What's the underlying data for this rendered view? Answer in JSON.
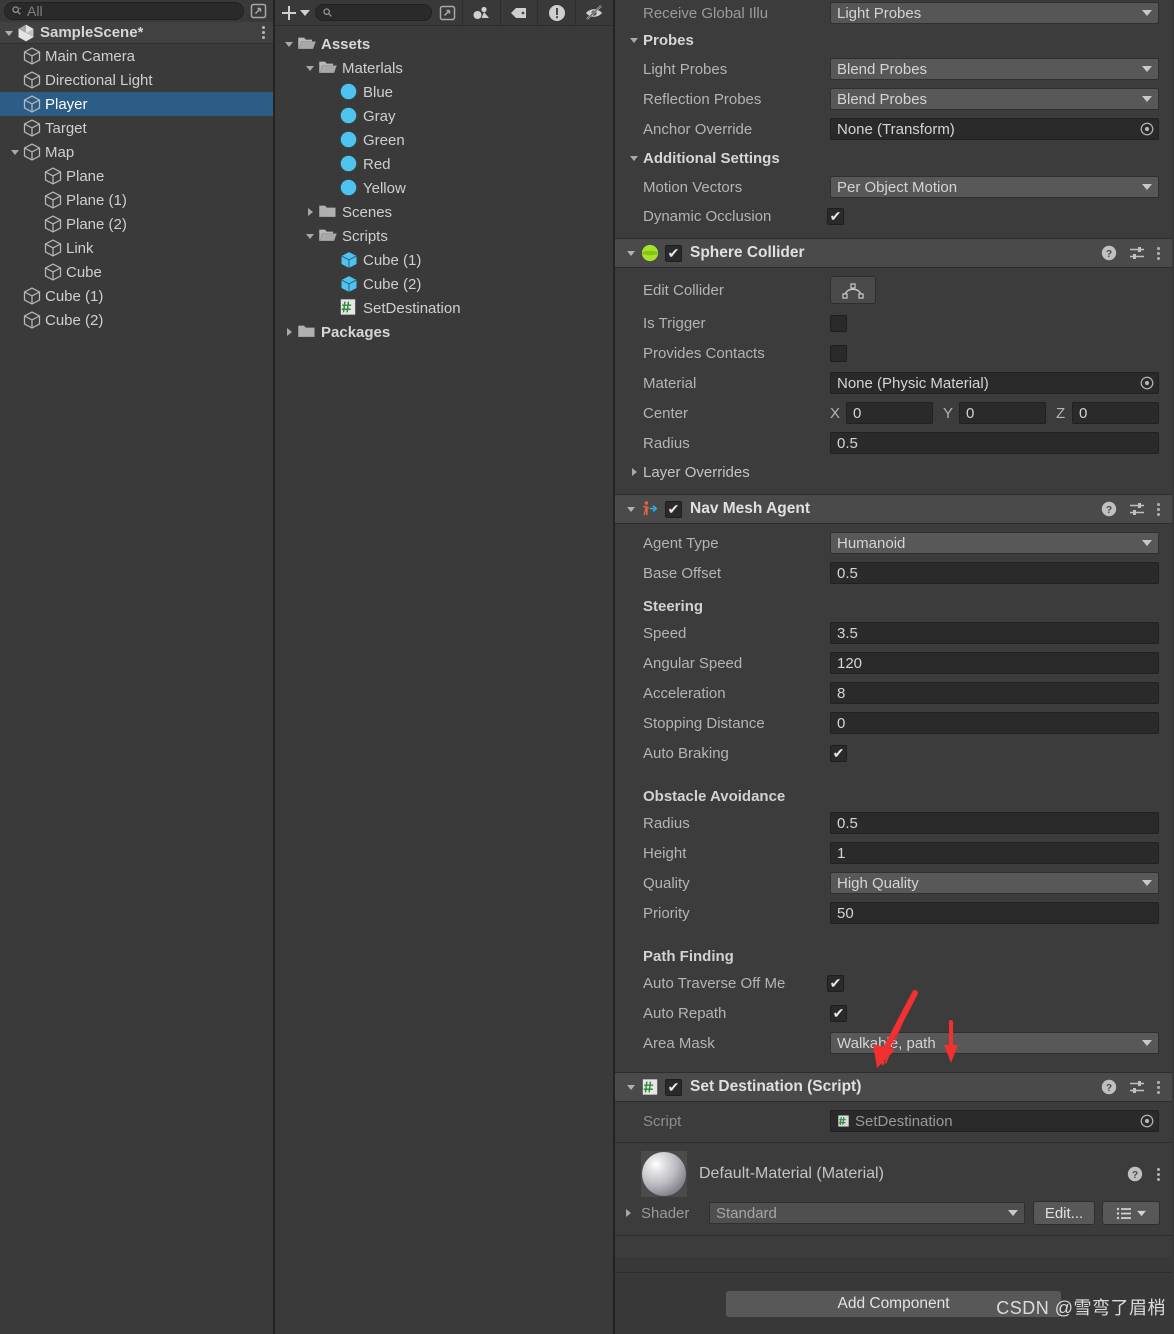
{
  "hierarchy": {
    "search": {
      "placeholder": "All",
      "icon": "search-icon"
    },
    "scene": {
      "name": "SampleScene*",
      "icon": "unity-scene-icon"
    },
    "items": [
      {
        "label": "Main Camera",
        "depth": 1,
        "expandable": false,
        "selected": false
      },
      {
        "label": "Directional Light",
        "depth": 1,
        "expandable": false,
        "selected": false
      },
      {
        "label": "Player",
        "depth": 1,
        "expandable": false,
        "selected": true
      },
      {
        "label": "Target",
        "depth": 1,
        "expandable": false,
        "selected": false
      },
      {
        "label": "Map",
        "depth": 1,
        "expandable": true,
        "expanded": true,
        "selected": false
      },
      {
        "label": "Plane",
        "depth": 2,
        "expandable": false,
        "selected": false
      },
      {
        "label": "Plane (1)",
        "depth": 2,
        "expandable": false,
        "selected": false
      },
      {
        "label": "Plane (2)",
        "depth": 2,
        "expandable": false,
        "selected": false
      },
      {
        "label": "Link",
        "depth": 2,
        "expandable": false,
        "selected": false
      },
      {
        "label": "Cube",
        "depth": 2,
        "expandable": false,
        "selected": false
      },
      {
        "label": "Cube (1)",
        "depth": 1,
        "expandable": false,
        "selected": false
      },
      {
        "label": "Cube (2)",
        "depth": 1,
        "expandable": false,
        "selected": false
      }
    ]
  },
  "project": {
    "toolbar": {
      "create_label": "+",
      "search_placeholder": "",
      "icons": [
        "plus-icon",
        "chevron-down-icon",
        "search-icon",
        "expand-icon",
        "favorite-icon",
        "label-icon",
        "error-icon",
        "hidden-icon"
      ]
    },
    "items": [
      {
        "label": "Assets",
        "depth": 0,
        "kind": "folder-open",
        "expandable": true,
        "expanded": true,
        "bold": true
      },
      {
        "label": "Materlals",
        "depth": 1,
        "kind": "folder-open",
        "expandable": true,
        "expanded": true,
        "bold": false
      },
      {
        "label": "Blue",
        "depth": 2,
        "kind": "material",
        "expandable": false,
        "bold": false
      },
      {
        "label": "Gray",
        "depth": 2,
        "kind": "material",
        "expandable": false,
        "bold": false
      },
      {
        "label": "Green",
        "depth": 2,
        "kind": "material",
        "expandable": false,
        "bold": false
      },
      {
        "label": "Red",
        "depth": 2,
        "kind": "material",
        "expandable": false,
        "bold": false
      },
      {
        "label": "Yellow",
        "depth": 2,
        "kind": "material",
        "expandable": false,
        "bold": false
      },
      {
        "label": "Scenes",
        "depth": 1,
        "kind": "folder",
        "expandable": true,
        "expanded": false,
        "bold": false
      },
      {
        "label": "Scripts",
        "depth": 1,
        "kind": "folder-open",
        "expandable": true,
        "expanded": true,
        "bold": false
      },
      {
        "label": "Cube (1)",
        "depth": 2,
        "kind": "prefab",
        "expandable": false,
        "bold": false
      },
      {
        "label": "Cube (2)",
        "depth": 2,
        "kind": "prefab",
        "expandable": false,
        "bold": false
      },
      {
        "label": "SetDestination",
        "depth": 2,
        "kind": "script",
        "expandable": false,
        "bold": false
      },
      {
        "label": "Packages",
        "depth": 0,
        "kind": "folder",
        "expandable": true,
        "expanded": false,
        "bold": true
      }
    ]
  },
  "inspector": {
    "renderer_tail": {
      "receive_gi_label": "Receive Global Illu",
      "receive_gi_value": "Light Probes",
      "probes_header": "Probes",
      "light_probes_label": "Light Probes",
      "light_probes_value": "Blend Probes",
      "reflection_probes_label": "Reflection Probes",
      "reflection_probes_value": "Blend Probes",
      "anchor_override_label": "Anchor Override",
      "anchor_override_value": "None (Transform)",
      "additional_settings_header": "Additional Settings",
      "motion_vectors_label": "Motion Vectors",
      "motion_vectors_value": "Per Object Motion",
      "dynamic_occlusion_label": "Dynamic Occlusion",
      "dynamic_occlusion_checked": true
    },
    "sphere_collider": {
      "title": "Sphere Collider",
      "enabled": true,
      "icon": "sphere-collider-icon",
      "edit_collider_label": "Edit Collider",
      "is_trigger_label": "Is Trigger",
      "is_trigger_checked": false,
      "provides_contacts_label": "Provides Contacts",
      "provides_contacts_checked": false,
      "material_label": "Material",
      "material_value": "None (Physic Material)",
      "center_label": "Center",
      "center_x_axis": "X",
      "center_x": "0",
      "center_y_axis": "Y",
      "center_y": "0",
      "center_z_axis": "Z",
      "center_z": "0",
      "radius_label": "Radius",
      "radius_value": "0.5",
      "layer_overrides_label": "Layer Overrides"
    },
    "nav_mesh_agent": {
      "title": "Nav Mesh Agent",
      "enabled": true,
      "icon": "nav-mesh-agent-icon",
      "agent_type_label": "Agent Type",
      "agent_type_value": "Humanoid",
      "base_offset_label": "Base Offset",
      "base_offset_value": "0.5",
      "steering_header": "Steering",
      "speed_label": "Speed",
      "speed_value": "3.5",
      "angular_speed_label": "Angular Speed",
      "angular_speed_value": "120",
      "acceleration_label": "Acceleration",
      "acceleration_value": "8",
      "stopping_distance_label": "Stopping Distance",
      "stopping_distance_value": "0",
      "auto_braking_label": "Auto Braking",
      "auto_braking_checked": true,
      "obstacle_avoidance_header": "Obstacle Avoidance",
      "oa_radius_label": "Radius",
      "oa_radius_value": "0.5",
      "oa_height_label": "Height",
      "oa_height_value": "1",
      "oa_quality_label": "Quality",
      "oa_quality_value": "High Quality",
      "oa_priority_label": "Priority",
      "oa_priority_value": "50",
      "path_finding_header": "Path Finding",
      "auto_traverse_label": "Auto Traverse Off Me",
      "auto_traverse_checked": true,
      "auto_repath_label": "Auto Repath",
      "auto_repath_checked": true,
      "area_mask_label": "Area Mask",
      "area_mask_value": "Walkable, path"
    },
    "set_destination": {
      "title": "Set Destination (Script)",
      "enabled": true,
      "icon": "script-icon",
      "script_label": "Script",
      "script_value": "SetDestination"
    },
    "material_card": {
      "title": "Default-Material (Material)",
      "shader_label": "Shader",
      "shader_value": "Standard",
      "edit_label": "Edit..."
    },
    "add_component_label": "Add Component",
    "header_icons": [
      "help-icon",
      "preset-icon",
      "kebab-menu-icon"
    ]
  },
  "watermark": {
    "text": "CSDN @雪弯了眉梢"
  },
  "annotations": {
    "arrow_long": {
      "color": "#f23030",
      "points_to": "area-mask-dropdown"
    },
    "arrow_short": {
      "color": "#f23030",
      "points_to": "area-mask-dropdown"
    }
  },
  "colors": {
    "panel_bg": "#383838",
    "panel_alt_bg": "#3c3c3c",
    "header_bg": "#4a4a4a",
    "selection_blue": "#2c5d87",
    "field_bg": "#2a2a2a",
    "dropdown_bg": "#585858",
    "accent_red": "#f23030",
    "material_icon": "#4ec3f0",
    "sphere_collider_green": "#a8e02c",
    "nav_agent_orange": "#e8643c"
  }
}
